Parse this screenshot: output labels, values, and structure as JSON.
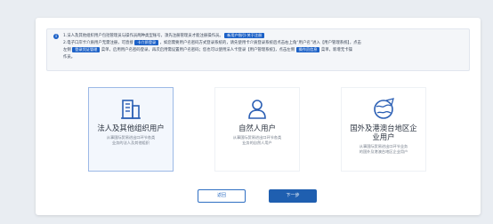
{
  "notice": {
    "line1_text": "1.法人及其他组织用户包括管理员与操作员两种类型账号，须先注册管理员才能注册操作员。",
    "link_guide": "新用户指引·关于注册",
    "line2_a": "2.电子口岸卡介质用户无需注册，可直接",
    "tag_card_login": "卡介质登录",
    "line2_b": "，如您需要用户名密码方式登录系统的，请先使用卡介质登录系统后点击右上角“用户名”进入【用户管理系统】，点击",
    "line3_a": "左侧",
    "tag_login_cred": "登录凭证管理",
    "line3_b": "菜单，启用用户名密码登录，再次启用需设置用户名密码；您也可以使用法人卡登录【用户管理系统】，点击左侧",
    "tag_op_info": "操作员信息",
    "line3_c": "菜单，新增无卡操",
    "line4": "作员。"
  },
  "cards": [
    {
      "icon": "building-icon",
      "title": "法人及其他组织用户",
      "desc": "从事国际贸易进出口环节各类业务的法人及其他组织",
      "selected": true
    },
    {
      "icon": "person-icon",
      "title": "自然人用户",
      "desc": "从事国际贸易进出口环节各类业务的自然人用户",
      "selected": false
    },
    {
      "icon": "globe-plane-icon",
      "title": "国外及港澳台地区企业用户",
      "desc": "从事国际贸易进出口环节业务的国外及港澳台地区企业用户",
      "selected": false
    }
  ],
  "buttons": {
    "back": "返回",
    "next": "下一步"
  },
  "colors": {
    "accent": "#1c61c7",
    "selected_border": "#9cb9e6"
  }
}
